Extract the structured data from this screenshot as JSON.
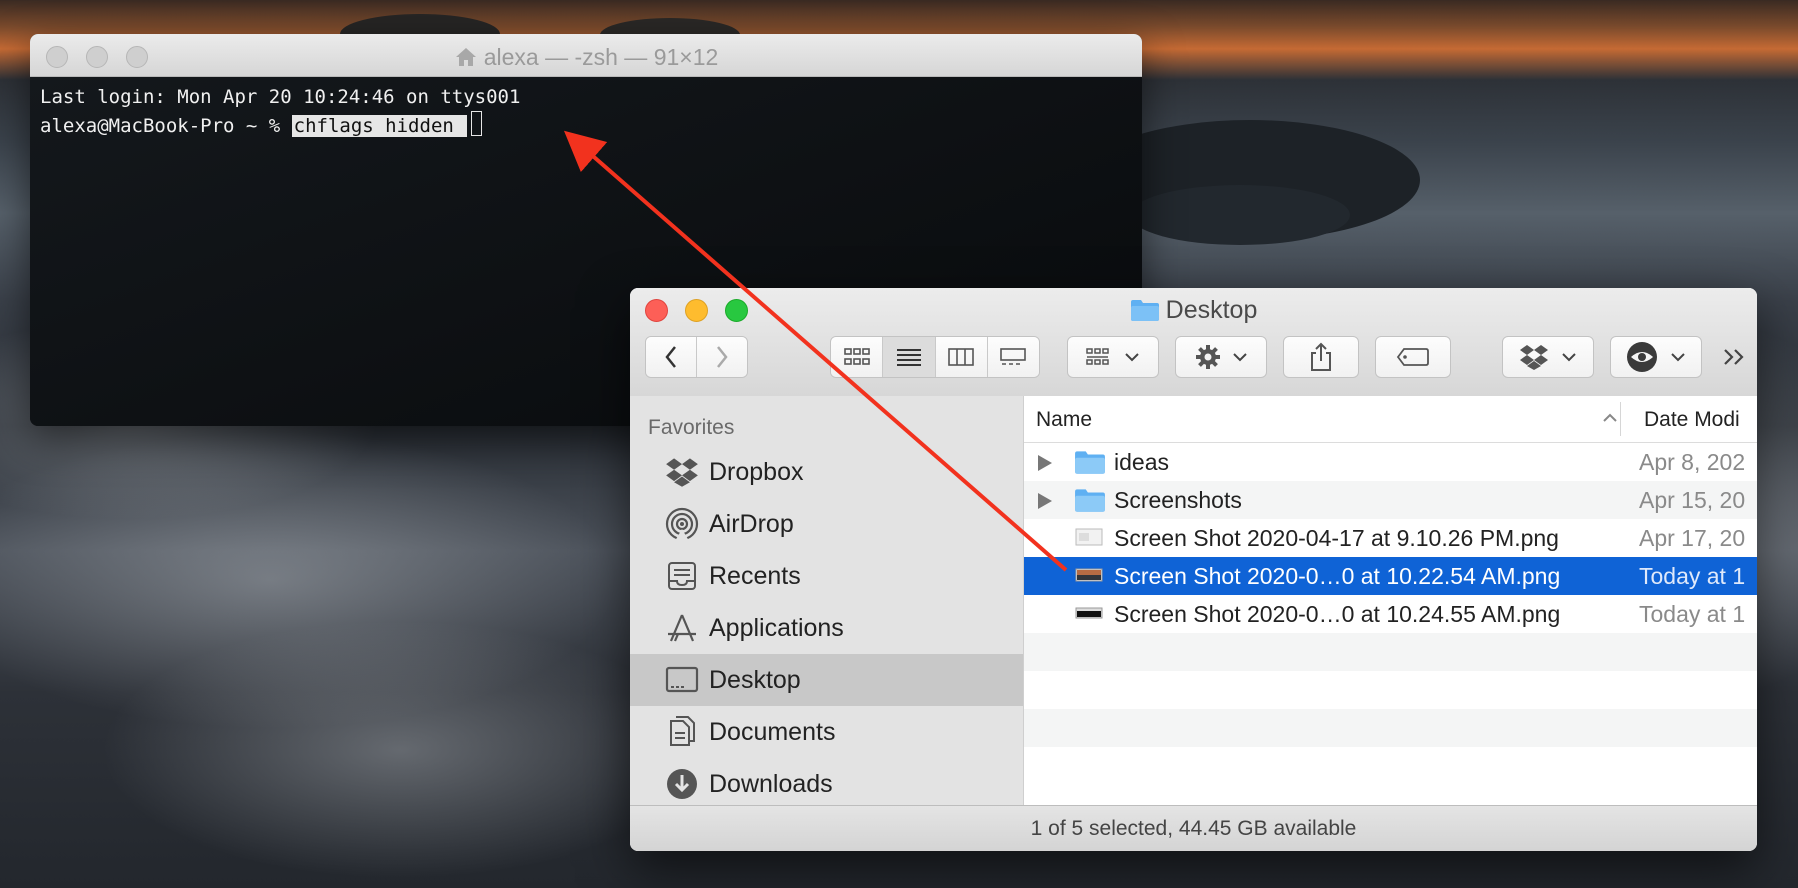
{
  "terminal": {
    "title": "alexa — -zsh — 91×12",
    "last_login": "Last login: Mon Apr 20 10:24:46 on ttys001",
    "prompt": "alexa@MacBook-Pro ~ % ",
    "command": "chflags hidden "
  },
  "finder": {
    "title": "Desktop",
    "sidebar": {
      "header": "Favorites",
      "items": [
        {
          "label": "Dropbox",
          "icon": "dropbox-icon"
        },
        {
          "label": "AirDrop",
          "icon": "airdrop-icon"
        },
        {
          "label": "Recents",
          "icon": "recents-icon"
        },
        {
          "label": "Applications",
          "icon": "applications-icon"
        },
        {
          "label": "Desktop",
          "icon": "desktop-icon"
        },
        {
          "label": "Documents",
          "icon": "documents-icon"
        },
        {
          "label": "Downloads",
          "icon": "downloads-icon"
        }
      ]
    },
    "columns": {
      "name": "Name",
      "date": "Date Modi"
    },
    "rows": [
      {
        "name": "ideas",
        "date": "Apr 8, 202",
        "kind": "folder"
      },
      {
        "name": "Screenshots",
        "date": "Apr 15, 20",
        "kind": "folder"
      },
      {
        "name": "Screen Shot 2020-04-17 at 9.10.26 PM.png",
        "date": "Apr 17, 20",
        "kind": "image"
      },
      {
        "name": "Screen Shot 2020-0…0 at 10.22.54 AM.png",
        "date": "Today at 1",
        "kind": "image"
      },
      {
        "name": "Screen Shot 2020-0…0 at 10.24.55 AM.png",
        "date": "Today at 1",
        "kind": "image"
      }
    ],
    "status": "1 of 5 selected, 44.45 GB available"
  },
  "colors": {
    "selection": "#0f63d6",
    "annotation_arrow": "#f2321e"
  }
}
